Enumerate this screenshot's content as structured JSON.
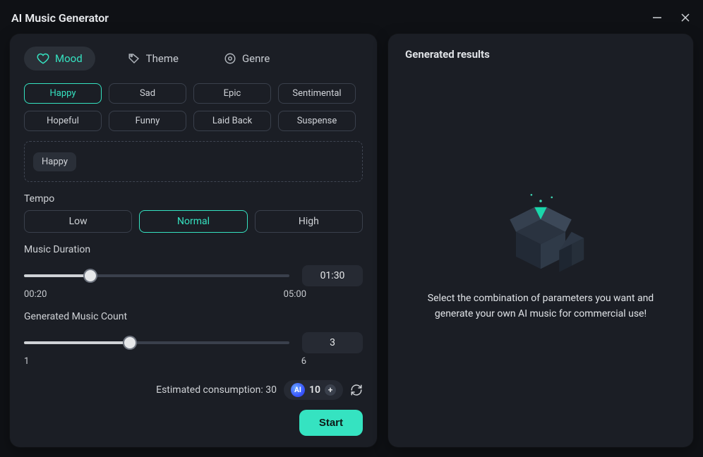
{
  "window": {
    "title": "AI Music Generator"
  },
  "tabs": {
    "items": [
      {
        "id": "mood",
        "label": "Mood",
        "icon": "heart-icon",
        "active": true
      },
      {
        "id": "theme",
        "label": "Theme",
        "icon": "tag-icon",
        "active": false
      },
      {
        "id": "genre",
        "label": "Genre",
        "icon": "disc-icon",
        "active": false
      }
    ]
  },
  "moods": {
    "options": [
      {
        "label": "Happy",
        "active": true
      },
      {
        "label": "Sad",
        "active": false
      },
      {
        "label": "Epic",
        "active": false
      },
      {
        "label": "Sentimental",
        "active": false
      },
      {
        "label": "Hopeful",
        "active": false
      },
      {
        "label": "Funny",
        "active": false
      },
      {
        "label": "Laid Back",
        "active": false
      },
      {
        "label": "Suspense",
        "active": false
      }
    ],
    "selected": [
      {
        "label": "Happy"
      }
    ]
  },
  "tempo": {
    "title": "Tempo",
    "options": [
      {
        "label": "Low",
        "active": false
      },
      {
        "label": "Normal",
        "active": true
      },
      {
        "label": "High",
        "active": false
      }
    ]
  },
  "duration": {
    "title": "Music Duration",
    "min_label": "00:20",
    "max_label": "05:00",
    "value_display": "01:30",
    "min_seconds": 20,
    "max_seconds": 300,
    "value_seconds": 90
  },
  "count": {
    "title": "Generated Music Count",
    "min_label": "1",
    "max_label": "6",
    "value_display": "3",
    "min": 1,
    "max": 6,
    "value": 3
  },
  "consumption": {
    "label_prefix": "Estimated consumption: ",
    "value": "30",
    "credits": "10"
  },
  "actions": {
    "start": "Start"
  },
  "results": {
    "title": "Generated results",
    "empty_message": "Select the combination of parameters you want and generate your own AI music for commercial use!"
  },
  "slider_geometry": {
    "duration_fill_percent": 25,
    "count_fill_percent": 40
  }
}
